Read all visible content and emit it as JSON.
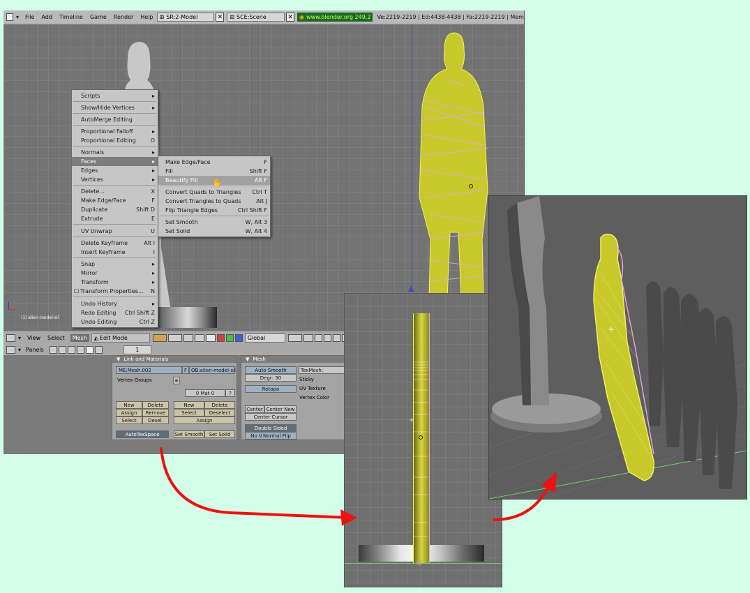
{
  "top_header": {
    "menus": [
      "File",
      "Add",
      "Timeline",
      "Game",
      "Render",
      "Help"
    ],
    "screen_field": "SR:2-Model",
    "scene_field": "SCE:Scene",
    "website": "www.blender.org 249.2",
    "stats": "Ve:2219-2219 | Ed:4438-4438 | Fa:2219-2219 | Mem"
  },
  "viewport": {
    "object_label": "(1) alien-model-sil"
  },
  "mesh_menu": {
    "items": [
      {
        "label": "Scripts",
        "shortcut": "▸"
      },
      {
        "label": "Show/Hide Vertices",
        "shortcut": "▸"
      },
      {
        "label": "AutoMerge Editing",
        "shortcut": ""
      },
      {
        "label": "Proportional Falloff",
        "shortcut": "▸"
      },
      {
        "label": "Proportional Editing",
        "shortcut": "O"
      },
      {
        "label": "Normals",
        "shortcut": "▸"
      },
      {
        "label": "Faces",
        "shortcut": "▸"
      },
      {
        "label": "Edges",
        "shortcut": "▸"
      },
      {
        "label": "Vertices",
        "shortcut": "▸"
      },
      {
        "label": "Delete...",
        "shortcut": "X"
      },
      {
        "label": "Make Edge/Face",
        "shortcut": "F"
      },
      {
        "label": "Duplicate",
        "shortcut": "Shift D"
      },
      {
        "label": "Extrude",
        "shortcut": "E"
      },
      {
        "label": "UV Unwrap",
        "shortcut": "U"
      },
      {
        "label": "Delete Keyframe",
        "shortcut": "Alt I"
      },
      {
        "label": "Insert Keyframe",
        "shortcut": "I"
      },
      {
        "label": "Snap",
        "shortcut": "▸"
      },
      {
        "label": "Mirror",
        "shortcut": "▸"
      },
      {
        "label": "Transform",
        "shortcut": "▸"
      },
      {
        "label": "Transform Properties...",
        "shortcut": "N"
      },
      {
        "label": "Undo History",
        "shortcut": "▸"
      },
      {
        "label": "Redo Editing",
        "shortcut": "Ctrl Shift Z"
      },
      {
        "label": "Undo Editing",
        "shortcut": "Ctrl Z"
      }
    ]
  },
  "faces_submenu": {
    "items": [
      {
        "label": "Make Edge/Face",
        "shortcut": "F"
      },
      {
        "label": "Fill",
        "shortcut": "Shift F"
      },
      {
        "label": "Beautify Fill",
        "shortcut": "Alt F"
      },
      {
        "label": "Convert Quads to Triangles",
        "shortcut": "Ctrl T"
      },
      {
        "label": "Convert Triangles to Quads",
        "shortcut": "Alt J"
      },
      {
        "label": "Flip Triangle Edges",
        "shortcut": "Ctrl Shift F"
      },
      {
        "label": "Set Smooth",
        "shortcut": "W, Alt 3"
      },
      {
        "label": "Set Solid",
        "shortcut": "W, Alt 4"
      }
    ]
  },
  "view_header": {
    "view": "View",
    "select": "Select",
    "mesh": "Mesh",
    "mode": "Edit Mode",
    "orientation": "Global"
  },
  "buttons_header": {
    "panels": "Panels",
    "frame": "1"
  },
  "link_materials": {
    "title": "Link and Materials",
    "mesh_name": "ME:Mesh.002",
    "f_label": "F",
    "object_name": "OB:alien-model-sil",
    "vertex_groups": "Vertex Groups",
    "mat_field": "0 Mat 0",
    "question": "?",
    "vg_buttons": [
      "New",
      "Delete",
      "Assign",
      "Remove",
      "Select",
      "Desel."
    ],
    "mat_buttons": [
      "New",
      "Delete",
      "Select",
      "Deselect",
      "Assign"
    ],
    "autotexspace": "AutoTexSpace",
    "set_smooth": "Set Smooth",
    "set_solid": "Set Solid"
  },
  "mesh_panel": {
    "title": "Mesh",
    "auto_smooth": "Auto Smooth",
    "degr": "Degr: 30",
    "retopo": "Retopo",
    "center": "Center",
    "center_new": "Center New",
    "center_cursor": "Center Cursor",
    "double_sided": "Double Sided",
    "no_v_normal_flip": "No V.Normal Flip",
    "texmesh": "TexMesh:",
    "sticky": "Sticky",
    "uv_texture": "UV Texture",
    "vertex_color": "Vertex Color"
  },
  "colors": {
    "background": "#d3ffe9",
    "arrow": "#ee1111",
    "mesh_yellow": "#c8c82a",
    "mesh_pink": "#e0a8e0"
  }
}
